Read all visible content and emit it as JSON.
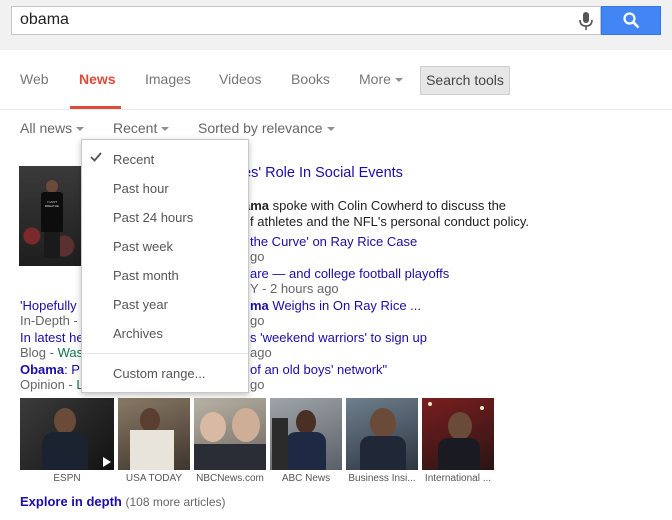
{
  "search": {
    "query": "obama"
  },
  "tabs": [
    {
      "label": "Web"
    },
    {
      "label": "News"
    },
    {
      "label": "Images"
    },
    {
      "label": "Videos"
    },
    {
      "label": "Books"
    },
    {
      "label": "More"
    }
  ],
  "search_tools_label": "Search tools",
  "filters": {
    "all_news": "All news",
    "recent": "Recent",
    "sorted": "Sorted by relevance"
  },
  "dropdown": {
    "items": [
      "Recent",
      "Past hour",
      "Past 24 hours",
      "Past week",
      "Past month",
      "Past year",
      "Archives"
    ],
    "custom": "Custom range..."
  },
  "result1": {
    "title": "es' Role In Social Events",
    "snippet1_bold": "ama",
    "snippet1": " spoke with Colin Cowherd to discuss the",
    "snippet2": "f athletes and the NFL's personal conduct policy.",
    "link1": " the Curve' on Ray Rice Case",
    "meta1": "go",
    "link2": "are — and college football playoffs",
    "meta2": "Y - 2 hours ago"
  },
  "result2": {
    "left_title": "'Hopefully",
    "left_meta": "In-Depth -",
    "right_title_bold": "ma",
    "right_title": " Weighs in On Ray Rice ...",
    "right_meta": "go",
    "l2_left": "In latest he",
    "l2_right": "s 'weekend warriors' to sign up",
    "l2_meta_left": "Blog - ",
    "l2_meta_was": "Was",
    "l2_meta_right": "ago",
    "l3_left_bold": "Obama",
    "l3_left": ": P",
    "l3_right": "of an old boys' network\"",
    "l3_meta_left": "Opinion - ",
    "l3_meta_L": "L",
    "l3_meta_right": "go"
  },
  "image_strip": [
    {
      "caption": "ESPN"
    },
    {
      "caption": "USA TODAY"
    },
    {
      "caption": "NBCNews.com"
    },
    {
      "caption": "ABC News"
    },
    {
      "caption": "Business Insi..."
    },
    {
      "caption": "International ..."
    }
  ],
  "explore": {
    "link": "Explore in depth",
    "count": "(108 more articles)"
  },
  "shirt_text": "I CAN'T BREATHE",
  "colors": {
    "accent_red": "#dd4b39",
    "link_blue": "#1a0dab",
    "search_blue": "#4285f4"
  }
}
